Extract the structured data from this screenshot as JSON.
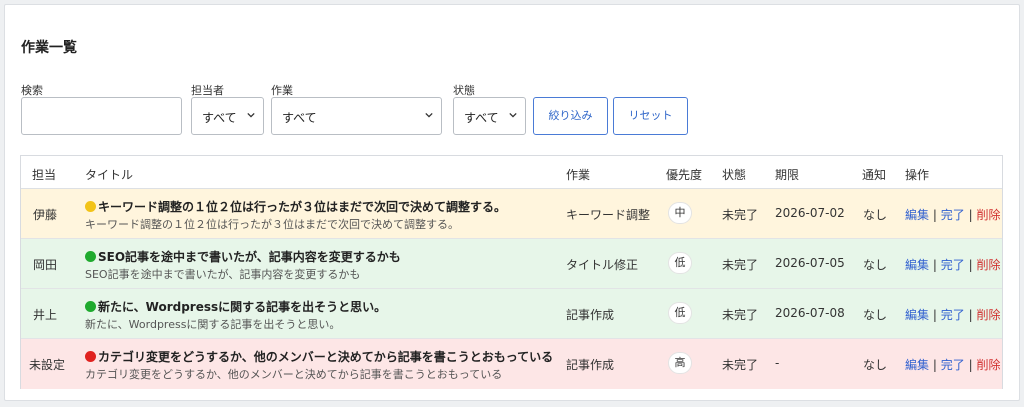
{
  "page": {
    "title": "作業一覧"
  },
  "filters": {
    "search": {
      "label": "検索",
      "value": ""
    },
    "assignee": {
      "label": "担当者",
      "value": "すべて"
    },
    "task": {
      "label": "作業",
      "value": "すべて"
    },
    "status": {
      "label": "状態",
      "value": "すべて"
    },
    "apply_label": "絞り込み",
    "reset_label": "リセット"
  },
  "table": {
    "headers": [
      "担当",
      "タイトル",
      "作業",
      "優先度",
      "状態",
      "期限",
      "通知",
      "操作"
    ],
    "rows": [
      {
        "assignee": "伊藤",
        "status_dot_color": "#f2c318",
        "title": "キーワード調整の１位２位は行ったが３位はまだで次回で決めて調整する。",
        "subtitle": "キーワード調整の１位２位は行ったが３位はまだで次回で決めて調整する。",
        "task": "キーワード調整",
        "priority": "中",
        "status": "未完了",
        "due": "2026-07-02",
        "notify": "なし",
        "row_color": "yellow"
      },
      {
        "assignee": "岡田",
        "status_dot_color": "#1faa2e",
        "title": "SEO記事を途中まで書いたが、記事内容を変更するかも",
        "subtitle": "SEO記事を途中まで書いたが、記事内容を変更するかも",
        "task": "タイトル修正",
        "priority": "低",
        "status": "未完了",
        "due": "2026-07-05",
        "notify": "なし",
        "row_color": "green"
      },
      {
        "assignee": "井上",
        "status_dot_color": "#1faa2e",
        "title": "新たに、Wordpressに関する記事を出そうと思い。",
        "subtitle": "新たに、Wordpressに関する記事を出そうと思い。",
        "task": "記事作成",
        "priority": "低",
        "status": "未完了",
        "due": "2026-07-08",
        "notify": "なし",
        "row_color": "green"
      },
      {
        "assignee": "未設定",
        "status_dot_color": "#e0221f",
        "title": "カテゴリ変更をどうするか、他のメンバーと決めてから記事を書こうとおもっている",
        "subtitle": "カテゴリ変更をどうするか、他のメンバーと決めてから記事を書こうとおもっている",
        "task": "記事作成",
        "priority": "高",
        "status": "未完了",
        "due": "-",
        "notify": "なし",
        "row_color": "red"
      }
    ],
    "actions": {
      "edit": "編集",
      "complete": "完了",
      "delete": "削除",
      "separator": "|"
    }
  }
}
